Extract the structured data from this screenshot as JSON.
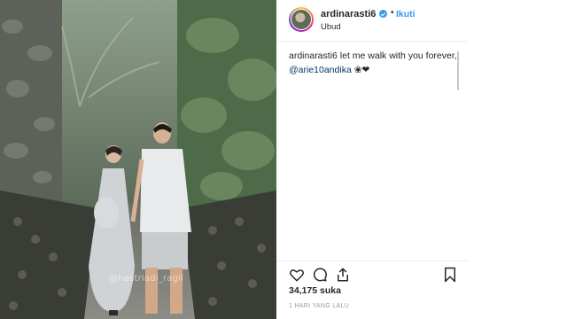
{
  "post": {
    "username": "ardinarasti6",
    "follow_dot": "•",
    "follow_label": "Ikuti",
    "location": "Ubud",
    "caption": {
      "user": "ardinarasti6",
      "text": " let me walk with you forever,",
      "mention": "@arie10andika",
      "emoji": " ❀❤"
    },
    "watermark": "@hastriadi_ragil",
    "likes": "34,175 suka",
    "timestamp": "1 HARI YANG LALU",
    "icons": [
      "heart-icon",
      "comment-icon",
      "share-icon",
      "bookmark-icon"
    ],
    "colors": {
      "link_blue": "#3897f0",
      "mention_blue": "#003569",
      "text": "#262626",
      "muted": "#999999"
    }
  }
}
